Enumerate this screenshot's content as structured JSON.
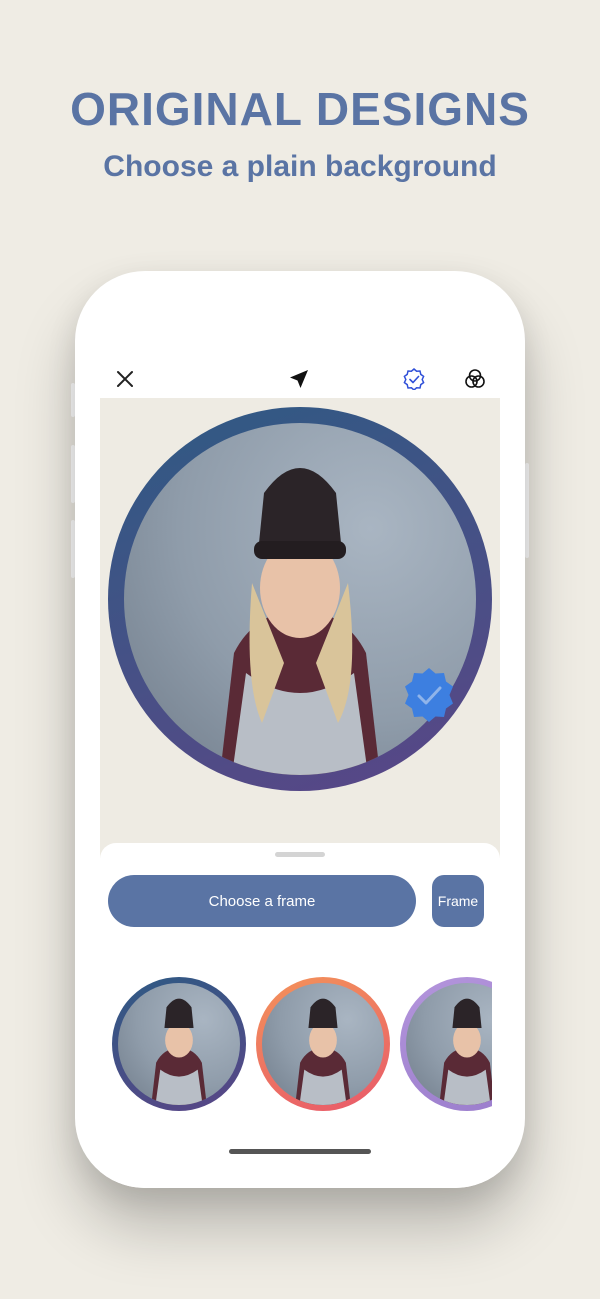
{
  "promo": {
    "title": "ORIGINAL DESIGNS",
    "subtitle": "Choose a plain background"
  },
  "toolbar": {
    "icons": [
      "close-icon",
      "send-icon",
      "verified-badge-icon",
      "color-filter-icon"
    ],
    "active_icon_color": "#2f4fd8"
  },
  "editor": {
    "frame_gradient": [
      "#2e5a84",
      "#5a4587"
    ],
    "badge_color": "#3d7fe0"
  },
  "sheet": {
    "choose_frame_label": "Choose a frame",
    "frame_tab_label": "Frame"
  },
  "frame_options": [
    {
      "name": "blue-purple",
      "gradient": [
        "#2e5a84",
        "#5a4587"
      ]
    },
    {
      "name": "orange-red",
      "gradient": [
        "#f3935a",
        "#e8596a"
      ]
    },
    {
      "name": "lavender",
      "gradient": [
        "#b495dc",
        "#9a7dcc"
      ]
    }
  ],
  "colors": {
    "accent": "#5a74a4",
    "background": "#efece4"
  }
}
